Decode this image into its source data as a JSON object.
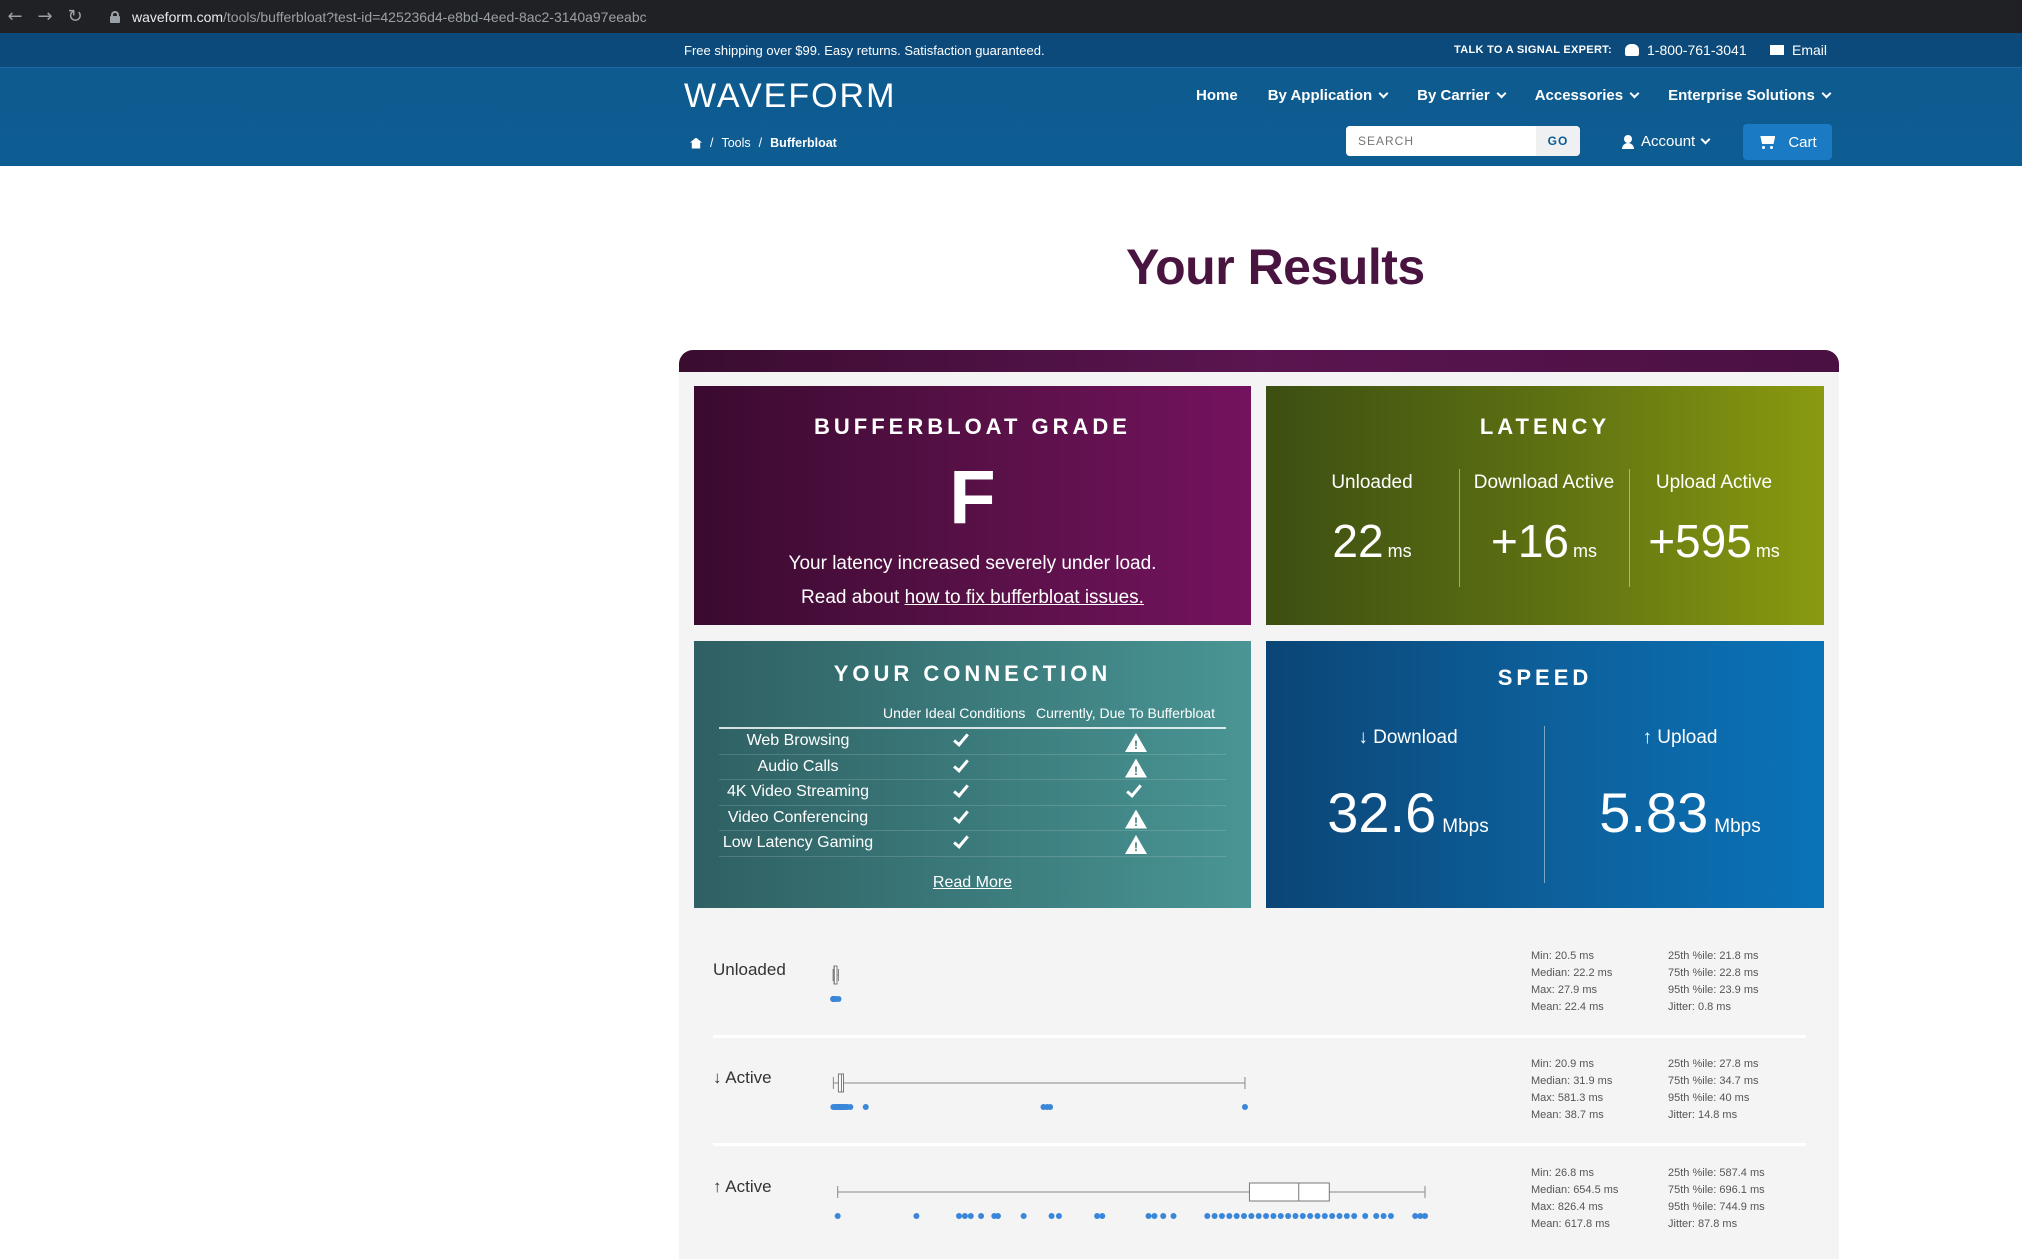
{
  "browser": {
    "url_domain": "waveform.com",
    "url_path": "/tools/bufferbloat?test-id=425236d4-e8bd-4eed-8ac2-3140a97eeabc"
  },
  "topbar": {
    "promo": "Free shipping over $99. Easy returns. Satisfaction guaranteed.",
    "talk": "TALK TO A SIGNAL EXPERT:",
    "phone": "1-800-761-3041",
    "email": "Email"
  },
  "header": {
    "logo": "WAVEFORM",
    "nav": [
      "Home",
      "By Application",
      "By Carrier",
      "Accessories",
      "Enterprise Solutions"
    ],
    "breadcrumb": {
      "tools": "Tools",
      "current": "Bufferbloat"
    },
    "search_placeholder": "SEARCH",
    "search_go": "GO",
    "account": "Account",
    "cart": "Cart"
  },
  "page": {
    "title": "Your Results"
  },
  "grade": {
    "title": "BUFFERBLOAT GRADE",
    "letter": "F",
    "line1": "Your latency increased severely under load.",
    "line2_prefix": "Read about ",
    "link": "how to fix bufferbloat issues."
  },
  "latency": {
    "title": "LATENCY",
    "cols": [
      {
        "label": "Unloaded",
        "value": "22",
        "unit": "ms"
      },
      {
        "label": "Download Active",
        "value": "+16",
        "unit": "ms"
      },
      {
        "label": "Upload Active",
        "value": "+595",
        "unit": "ms"
      }
    ]
  },
  "connection": {
    "title": "YOUR CONNECTION",
    "head_ideal": "Under Ideal Conditions",
    "head_current": "Currently, Due To Bufferbloat",
    "rows": [
      {
        "name": "Web Browsing",
        "ideal": "check",
        "current": "warning"
      },
      {
        "name": "Audio Calls",
        "ideal": "check",
        "current": "warning"
      },
      {
        "name": "4K Video Streaming",
        "ideal": "check",
        "current": "check"
      },
      {
        "name": "Video Conferencing",
        "ideal": "check",
        "current": "warning"
      },
      {
        "name": "Low Latency Gaming",
        "ideal": "check",
        "current": "warning"
      }
    ],
    "read_more": "Read More"
  },
  "speed": {
    "title": "SPEED",
    "download_label": "↓ Download",
    "download_value": "32.6",
    "upload_label": "↑ Upload",
    "upload_value": "5.83",
    "unit": "Mbps"
  },
  "distribution": {
    "axis_max_ms": 826.4,
    "rows": [
      {
        "label": "Unloaded",
        "stats_left": [
          "Min: 20.5 ms",
          "Median: 22.2 ms",
          "Max: 27.9 ms",
          "Mean: 22.4 ms"
        ],
        "stats_right": [
          "25th %ile: 21.8 ms",
          "75th %ile: 22.8 ms",
          "95th %ile: 23.9 ms",
          "Jitter: 0.8 ms"
        ],
        "min": 20.5,
        "q1": 21.8,
        "median": 22.2,
        "q3": 22.8,
        "max": 27.9,
        "points": [
          20.5,
          21,
          21.5,
          21.8,
          22,
          22.2,
          22.4,
          22.6,
          22.8,
          23.2,
          23.9,
          27.9
        ]
      },
      {
        "label": "↓ Active",
        "stats_left": [
          "Min: 20.9 ms",
          "Median: 31.9 ms",
          "Max: 581.3 ms",
          "Mean: 38.7 ms"
        ],
        "stats_right": [
          "25th %ile: 27.8 ms",
          "75th %ile: 34.7 ms",
          "95th %ile: 40 ms",
          "Jitter: 14.8 ms"
        ],
        "min": 20.9,
        "q1": 27.8,
        "median": 31.9,
        "q3": 34.7,
        "max": 581.3,
        "points": [
          20.9,
          23,
          25,
          27,
          28,
          29,
          30,
          31,
          32,
          33,
          34,
          35,
          36,
          38,
          40,
          44,
          65,
          307,
          312,
          316,
          581.3
        ]
      },
      {
        "label": "↑ Active",
        "stats_left": [
          "Min: 26.8 ms",
          "Median: 654.5 ms",
          "Max: 826.4 ms",
          "Mean: 617.8 ms"
        ],
        "stats_right": [
          "25th %ile: 587.4 ms",
          "75th %ile: 696.1 ms",
          "95th %ile: 744.9 ms",
          "Jitter: 87.8 ms"
        ],
        "min": 26.8,
        "q1": 587.4,
        "median": 654.5,
        "q3": 696.1,
        "max": 826.4,
        "points": [
          26.8,
          134,
          192,
          200,
          208,
          222,
          240,
          245,
          280,
          318,
          328,
          380,
          387,
          450,
          458,
          470,
          484,
          530,
          540,
          550,
          560,
          570,
          580,
          590,
          600,
          610,
          620,
          630,
          640,
          650,
          660,
          670,
          680,
          690,
          700,
          710,
          720,
          730,
          745,
          760,
          770,
          780,
          813,
          820,
          826.4
        ]
      }
    ]
  },
  "colors": {
    "title": "#4a1440",
    "grade_bg": "#5a1148",
    "latency_bg": "#5d7012",
    "connection_bg": "#3b7a7b",
    "speed_bg": "#0d5f9a",
    "dot": "#3a86d8"
  }
}
